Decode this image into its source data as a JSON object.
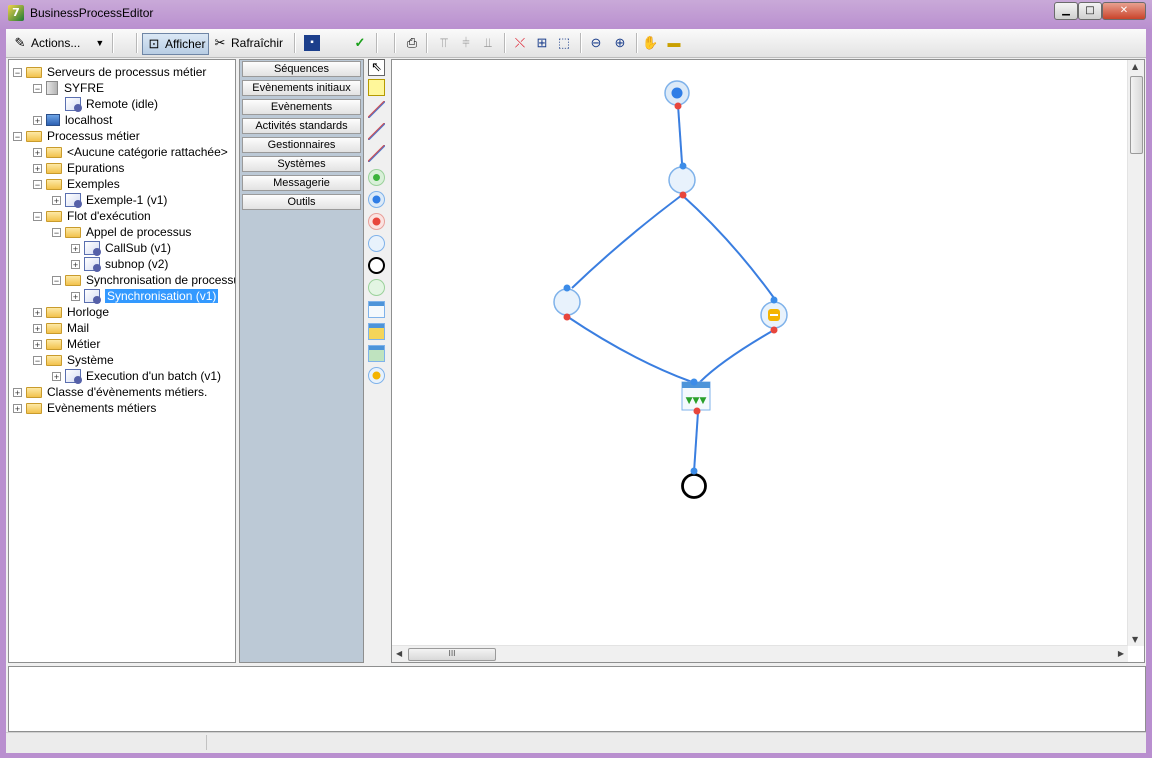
{
  "window": {
    "title": "BusinessProcessEditor",
    "app_icon_glyph": "7",
    "min_label": "▁",
    "max_label": "□",
    "close_label": "✕"
  },
  "toolbar": {
    "actions_label": "Actions...",
    "afficher_label": "Afficher",
    "rafraichir_label": "Rafraîchir",
    "icons": [
      "save-icon",
      "check-icon",
      "print-icon",
      "align-top-icon",
      "align-middle-icon",
      "align-bottom-icon",
      "delete-link-icon",
      "grid-icon",
      "select-area-icon",
      "zoom-out-icon",
      "zoom-in-icon",
      "pan-hand-icon",
      "ruler-icon"
    ]
  },
  "tree": {
    "nodes": [
      {
        "label": "Serveurs de processus métier",
        "expander": "−",
        "icon": "folder"
      },
      {
        "label": "SYFRE",
        "expander": "−",
        "icon": "server"
      },
      {
        "label": "Remote (idle)",
        "expander": "",
        "icon": "remote"
      },
      {
        "label": "localhost",
        "expander": "+",
        "icon": "pc"
      },
      {
        "label": "Processus métier",
        "expander": "−",
        "icon": "folder"
      },
      {
        "label": "<Aucune catégorie rattachée>",
        "expander": "+",
        "icon": "folder"
      },
      {
        "label": "Epurations",
        "expander": "+",
        "icon": "folder"
      },
      {
        "label": "Exemples",
        "expander": "−",
        "icon": "folder"
      },
      {
        "label": "Exemple-1 (v1)",
        "expander": "+",
        "icon": "proc"
      },
      {
        "label": "Flot d'exécution",
        "expander": "−",
        "icon": "folder"
      },
      {
        "label": "Appel de processus",
        "expander": "−",
        "icon": "folder"
      },
      {
        "label": "CallSub (v1)",
        "expander": "+",
        "icon": "proc"
      },
      {
        "label": "subnop (v2)",
        "expander": "+",
        "icon": "proc"
      },
      {
        "label": "Synchronisation de processus",
        "expander": "−",
        "icon": "folder"
      },
      {
        "label": "Synchronisation (v1)",
        "expander": "+",
        "icon": "proc"
      },
      {
        "label": "Horloge",
        "expander": "+",
        "icon": "folder"
      },
      {
        "label": "Mail",
        "expander": "+",
        "icon": "folder"
      },
      {
        "label": "Métier",
        "expander": "+",
        "icon": "folder"
      },
      {
        "label": "Système",
        "expander": "−",
        "icon": "folder"
      },
      {
        "label": "Execution d'un batch (v1)",
        "expander": "+",
        "icon": "proc"
      },
      {
        "label": "Classe d'évènements métiers.",
        "expander": "+",
        "icon": "folder"
      },
      {
        "label": "Evènements métiers",
        "expander": "+",
        "icon": "folder"
      }
    ]
  },
  "palette": {
    "categories": [
      "Séquences",
      "Evènements initiaux",
      "Evènements",
      "Activités standards",
      "Gestionnaires",
      "Systèmes",
      "Messagerie",
      "Outils"
    ]
  },
  "tools": [
    "pointer-tool-icon",
    "note-tool-icon",
    "link-tool-icon",
    "link2-tool-icon",
    "link3-tool-icon",
    "start-event-icon",
    "intermediate-event-icon",
    "cancel-event-icon",
    "activity-icon",
    "end-event-icon",
    "gateway-icon",
    "form-icon",
    "folder-action-icon",
    "sync-task-icon",
    "order-icon"
  ],
  "scroll": {
    "hthumb_grip": "III",
    "up": "▲",
    "down": "▼",
    "left": "◀",
    "right": "▶"
  },
  "colors": {
    "edge": "#3a7ee0",
    "in_port": "#3c8ce8",
    "out_port": "#e8463c",
    "selection": "#3399ff"
  }
}
